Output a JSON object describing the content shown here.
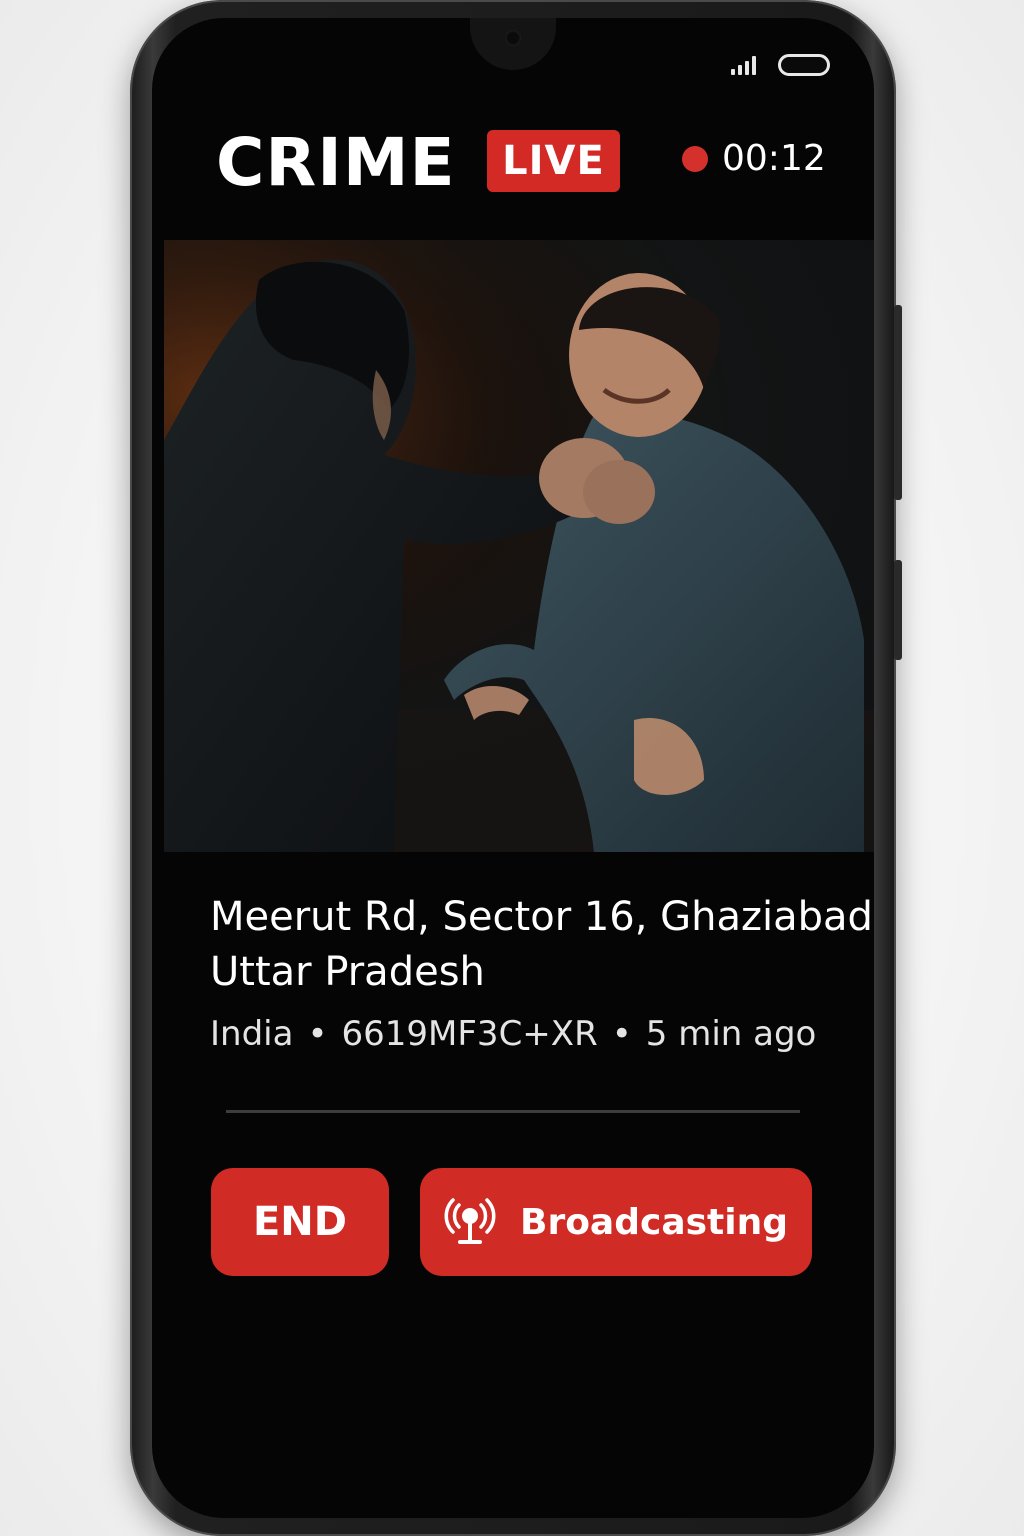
{
  "header": {
    "brand": "CRIME",
    "live_badge": "LIVE",
    "timer": "00:12"
  },
  "video": {
    "description_icon": "live-video-feed"
  },
  "location": {
    "line1": "Meerut Rd, Sector 16, Ghaziabad",
    "line2": "Uttar Pradesh",
    "country": "India",
    "plus_code": "6619MF3C+XR",
    "time_ago": "5 min ago",
    "separator": "•"
  },
  "actions": {
    "end_label": "END",
    "broadcast_label": "Broadcasting",
    "broadcast_icon": "broadcast-antenna-icon"
  },
  "colors": {
    "accent": "#d12b26",
    "rec_dot": "#d4302c",
    "background": "#050505"
  }
}
